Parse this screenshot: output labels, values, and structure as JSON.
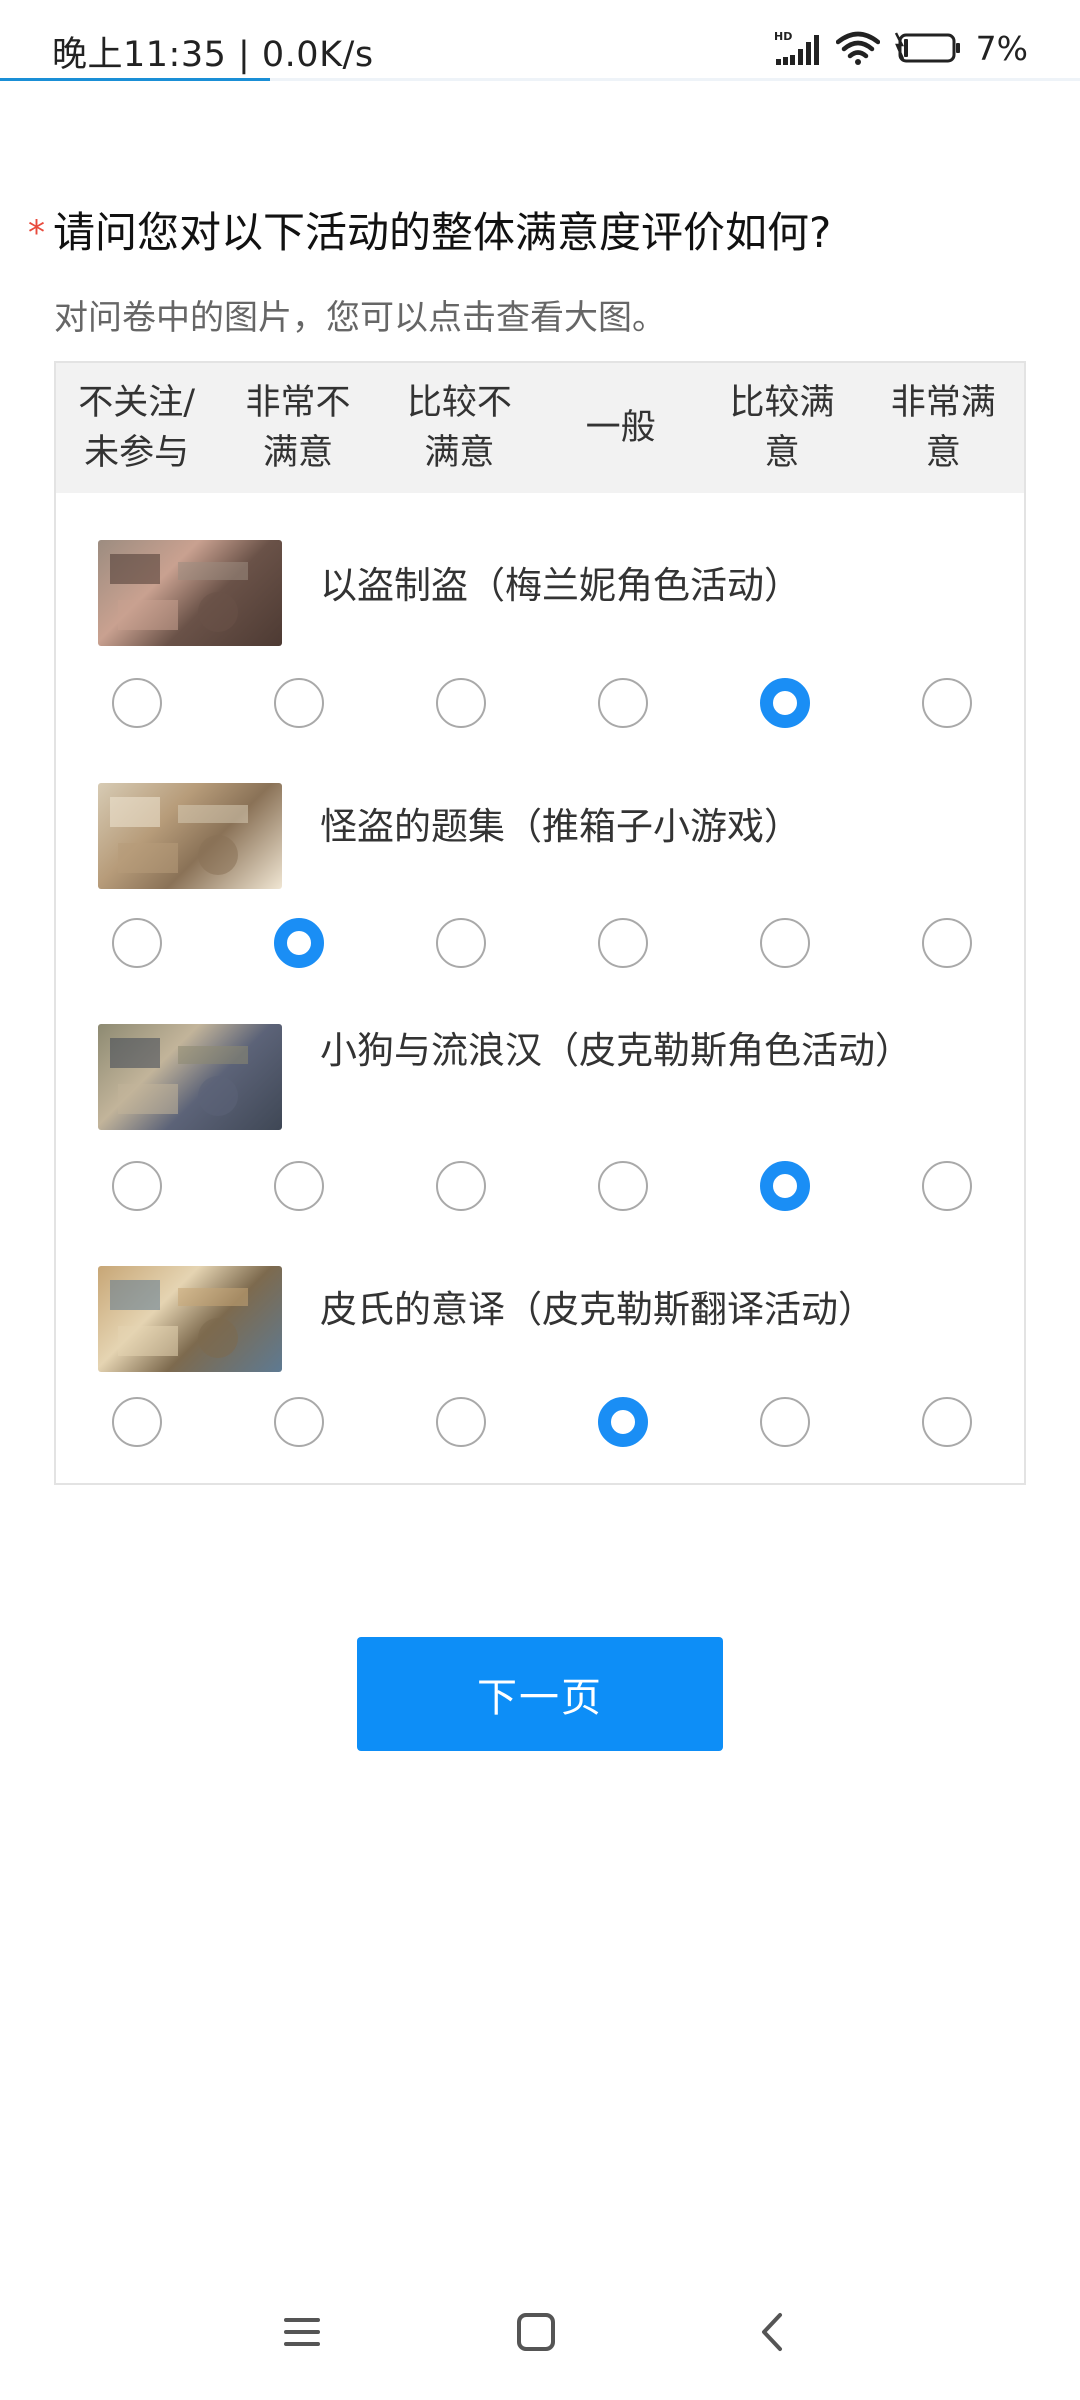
{
  "status_bar": {
    "time": "晚上11:35 | 0.0K/s",
    "network_label": "HD",
    "battery": "7%",
    "page_load_fraction": 0.25,
    "icons": [
      "hd-signal-icon",
      "wifi-icon",
      "battery-icon"
    ]
  },
  "question": {
    "required_mark": "*",
    "title": "请问您对以下活动的整体满意度评价如何?",
    "hint": "对问卷中的图片，您可以点击查看大图。"
  },
  "matrix": {
    "columns": [
      {
        "line1": "不关注/",
        "line2": "未参与"
      },
      {
        "line1": "非常不",
        "line2": "满意"
      },
      {
        "line1": "比较不",
        "line2": "满意"
      },
      {
        "line1": "一般",
        "line2": ""
      },
      {
        "line1": "比较满",
        "line2": "意"
      },
      {
        "line1": "非常满",
        "line2": "意"
      }
    ],
    "rows": [
      {
        "label": "以盗制盗（梅兰妮角色活动）",
        "selected_index": 4
      },
      {
        "label": "怪盗的题集（推箱子小游戏）",
        "selected_index": 1
      },
      {
        "label": "小狗与流浪汉（皮克勒斯角色活动）",
        "selected_index": 4
      },
      {
        "label": "皮氏的意译（皮克勒斯翻译活动）",
        "selected_index": 3
      }
    ]
  },
  "next_button": {
    "label": "下一页"
  },
  "nav_bar": {
    "icons": [
      "menu-icon",
      "home-icon",
      "back-icon"
    ]
  },
  "colors": {
    "accent": "#0d8ef7",
    "radio_checked": "#1a8ef5",
    "required_star": "#e84a3c",
    "header_bg": "#f2f2f2"
  }
}
